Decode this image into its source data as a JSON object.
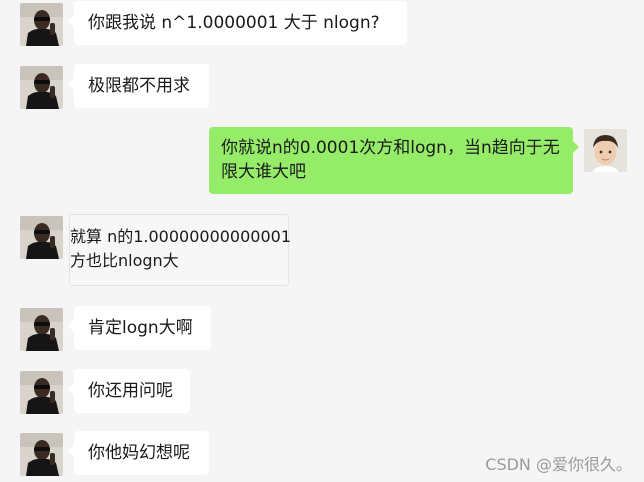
{
  "messages": [
    {
      "sender": "other",
      "text": "你跟我说 n^1.0000001 大于 nlogn?"
    },
    {
      "sender": "other",
      "text": "极限都不用求"
    },
    {
      "sender": "self",
      "text": "你就说n的0.0001次方和logn，当n趋向于无限大谁大吧"
    },
    {
      "sender": "other",
      "line1": "就算 n的1.00000000000001",
      "line2": "方也比nlogn大"
    },
    {
      "sender": "other",
      "text": "肯定logn大啊"
    },
    {
      "sender": "other",
      "text": "你还用问呢"
    },
    {
      "sender": "other",
      "text": "你他妈幻想呢"
    }
  ],
  "watermark": "CSDN @爱你很久。",
  "colors": {
    "background": "#f5f5f5",
    "incoming_bubble": "#ffffff",
    "outgoing_bubble": "#95ec69"
  },
  "icons": {
    "other_avatar": "avatar-man-sunglasses-icon",
    "self_avatar": "avatar-child-icon"
  }
}
